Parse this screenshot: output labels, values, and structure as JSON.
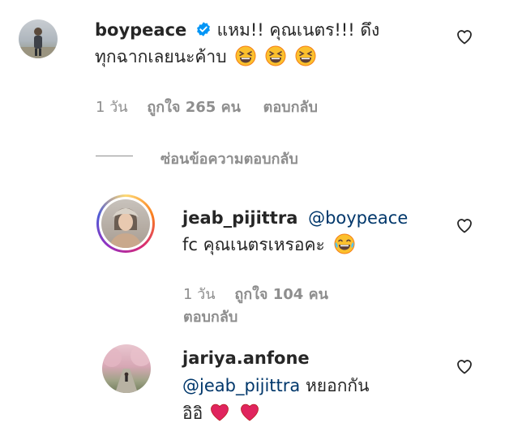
{
  "comments": [
    {
      "username": "boypeace",
      "verified": true,
      "text_line1": " แหม!! คุณเนตร!!! ดึง",
      "text_line2": "ทุกฉากเลยนะค้าบ ",
      "emoji": "grinning-squinting-face",
      "emoji_count": 3,
      "time": "1 วัน",
      "likes": "ถูกใจ 265 คน",
      "reply": "ตอบกลับ"
    }
  ],
  "hide_replies": "ซ่อนข้อความตอบกลับ",
  "replies": [
    {
      "username": "jeab_pijittra",
      "mention": "@boypeace",
      "text": "fc คุณเนตรเหรอคะ ",
      "emoji": "face-with-tears-of-joy",
      "time": "1 วัน",
      "likes": "ถูกใจ 104 คน",
      "reply": "ตอบกลับ"
    },
    {
      "username": "jariya.anfone",
      "mention": "@jeab_pijittra",
      "text_after_mention": " หยอกกัน",
      "text_line3": "อิอิ",
      "emoji": "red-heart",
      "emoji_count": 2
    }
  ],
  "colors": {
    "text": "#262626",
    "meta": "#8e8e8e",
    "mention": "#00376b",
    "verified": "#0095f6",
    "heart_red": "#e0245e"
  }
}
